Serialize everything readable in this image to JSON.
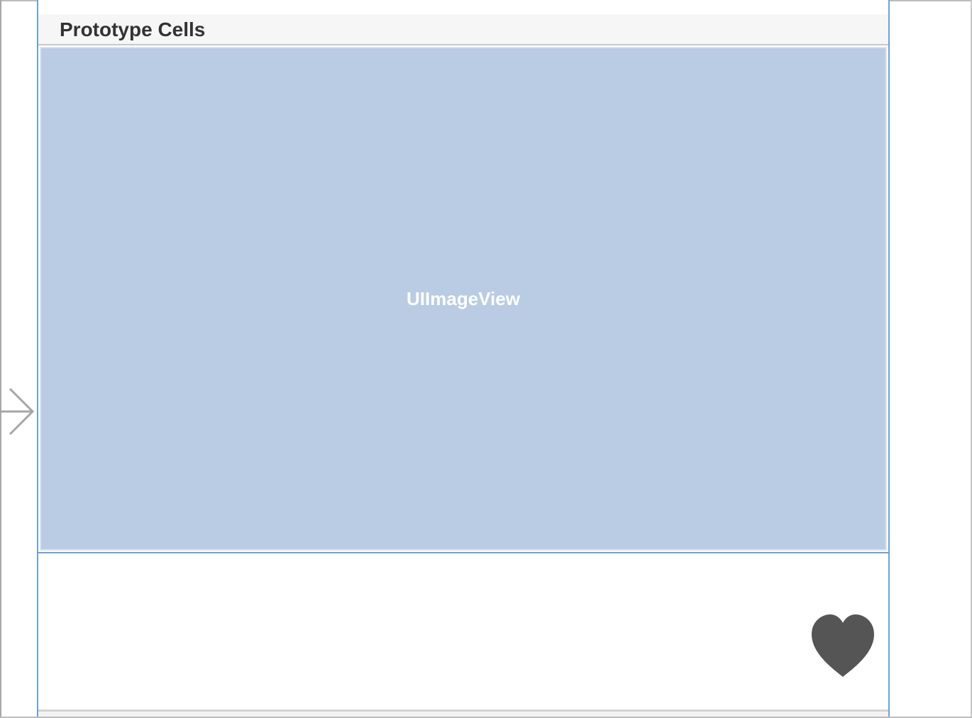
{
  "storyboard": {
    "section_header": "Prototype Cells",
    "image_view_label": "UIImageView",
    "icons": {
      "favorite": "heart-icon",
      "entry_point": "initial-view-controller-arrow-icon",
      "scene_dock": "scene-dock-icon"
    },
    "colors": {
      "selection_border": "#6aa3d9",
      "image_view_fill": "#b9cce3",
      "heart_fill": "#555555"
    }
  }
}
